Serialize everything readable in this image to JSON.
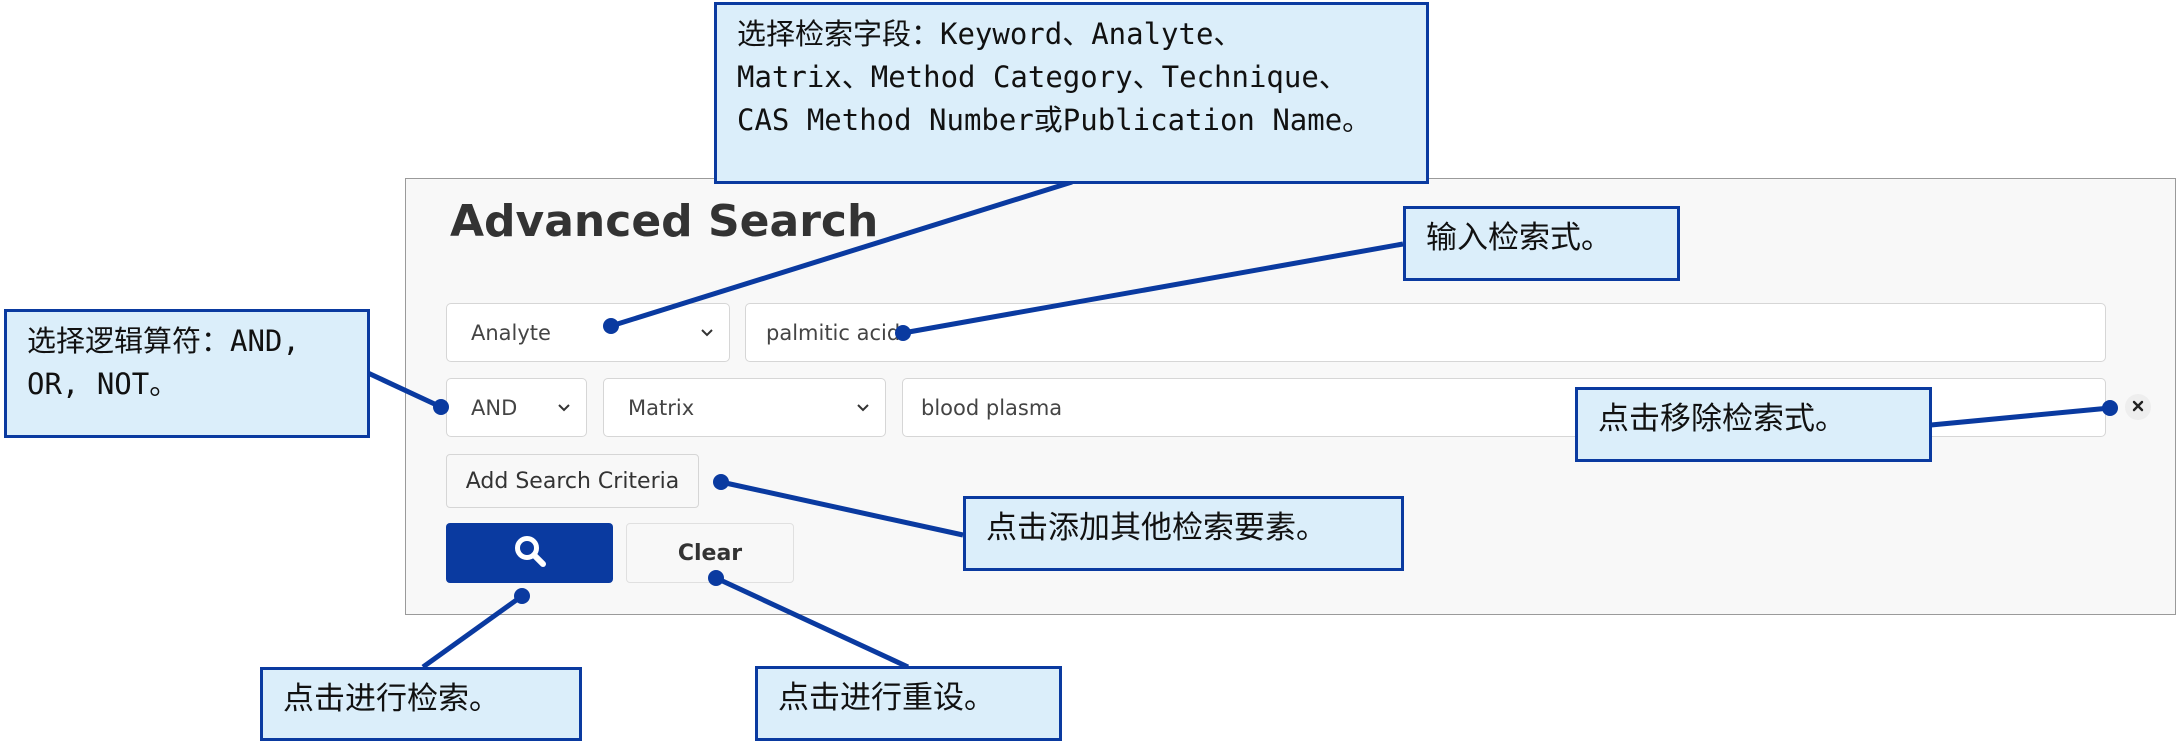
{
  "search_panel": {
    "title": "Advanced Search",
    "rows": [
      {
        "field_select": "Analyte",
        "term_value": "palmitic acid"
      },
      {
        "operator_select": "AND",
        "field_select": "Matrix",
        "term_value": "blood plasma"
      }
    ],
    "add_criteria_label": "Add Search Criteria",
    "search_icon": "search-icon",
    "clear_label": "Clear",
    "remove_icon": "close-icon"
  },
  "annotations": {
    "select_field": "选择检索字段：Keyword、Analyte、\nMatrix、Method Category、Technique、\nCAS Method Number或Publication Name。",
    "enter_query": "输入检索式。",
    "select_operator": "选择逻辑算符：AND,\nOR, NOT。",
    "remove_query": "点击移除检索式。",
    "add_criteria": "点击添加其他检索要素。",
    "do_search": "点击进行检索。",
    "do_reset": "点击进行重设。"
  },
  "colors": {
    "accent": "#0a3aa0",
    "callout_fill": "#dbeefa"
  }
}
